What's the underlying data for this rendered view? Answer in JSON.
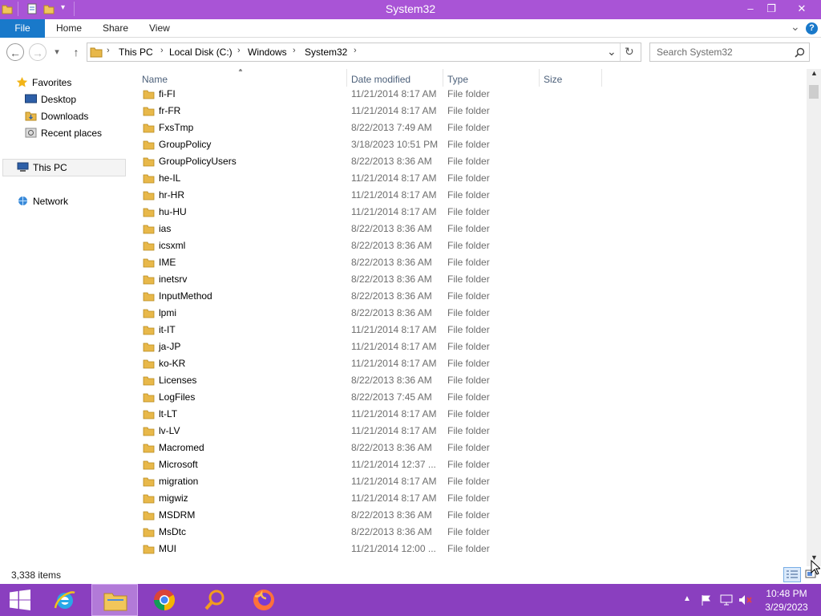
{
  "window": {
    "title": "System32",
    "minimize": "–",
    "restore": "❐",
    "close": "✕"
  },
  "ribbon": {
    "tabs": [
      "File",
      "Home",
      "Share",
      "View"
    ],
    "expand": "⌄",
    "help": "?"
  },
  "nav": {
    "back": "←",
    "forward": "→",
    "recent": "▾",
    "up": "↑",
    "breadcrumbs": [
      "This PC",
      "Local Disk (C:)",
      "Windows",
      "System32"
    ],
    "dropdown": "⌄",
    "refresh": "↻",
    "search_placeholder": "Search System32"
  },
  "sidebar": {
    "favorites": "Favorites",
    "favorite_items": [
      "Desktop",
      "Downloads",
      "Recent places"
    ],
    "this_pc": "This PC",
    "network": "Network"
  },
  "columns": {
    "name": "Name",
    "date": "Date modified",
    "type": "Type",
    "size": "Size"
  },
  "files": [
    {
      "name": "fi-FI",
      "date": "11/21/2014 8:17 AM",
      "type": "File folder"
    },
    {
      "name": "fr-FR",
      "date": "11/21/2014 8:17 AM",
      "type": "File folder"
    },
    {
      "name": "FxsTmp",
      "date": "8/22/2013 7:49 AM",
      "type": "File folder"
    },
    {
      "name": "GroupPolicy",
      "date": "3/18/2023 10:51 PM",
      "type": "File folder"
    },
    {
      "name": "GroupPolicyUsers",
      "date": "8/22/2013 8:36 AM",
      "type": "File folder"
    },
    {
      "name": "he-IL",
      "date": "11/21/2014 8:17 AM",
      "type": "File folder"
    },
    {
      "name": "hr-HR",
      "date": "11/21/2014 8:17 AM",
      "type": "File folder"
    },
    {
      "name": "hu-HU",
      "date": "11/21/2014 8:17 AM",
      "type": "File folder"
    },
    {
      "name": "ias",
      "date": "8/22/2013 8:36 AM",
      "type": "File folder"
    },
    {
      "name": "icsxml",
      "date": "8/22/2013 8:36 AM",
      "type": "File folder"
    },
    {
      "name": "IME",
      "date": "8/22/2013 8:36 AM",
      "type": "File folder"
    },
    {
      "name": "inetsrv",
      "date": "8/22/2013 8:36 AM",
      "type": "File folder"
    },
    {
      "name": "InputMethod",
      "date": "8/22/2013 8:36 AM",
      "type": "File folder"
    },
    {
      "name": "lpmi",
      "date": "8/22/2013 8:36 AM",
      "type": "File folder"
    },
    {
      "name": "it-IT",
      "date": "11/21/2014 8:17 AM",
      "type": "File folder"
    },
    {
      "name": "ja-JP",
      "date": "11/21/2014 8:17 AM",
      "type": "File folder"
    },
    {
      "name": "ko-KR",
      "date": "11/21/2014 8:17 AM",
      "type": "File folder"
    },
    {
      "name": "Licenses",
      "date": "8/22/2013 8:36 AM",
      "type": "File folder"
    },
    {
      "name": "LogFiles",
      "date": "8/22/2013 7:45 AM",
      "type": "File folder"
    },
    {
      "name": "lt-LT",
      "date": "11/21/2014 8:17 AM",
      "type": "File folder"
    },
    {
      "name": "lv-LV",
      "date": "11/21/2014 8:17 AM",
      "type": "File folder"
    },
    {
      "name": "Macromed",
      "date": "8/22/2013 8:36 AM",
      "type": "File folder"
    },
    {
      "name": "Microsoft",
      "date": "11/21/2014 12:37 ...",
      "type": "File folder"
    },
    {
      "name": "migration",
      "date": "11/21/2014 8:17 AM",
      "type": "File folder"
    },
    {
      "name": "migwiz",
      "date": "11/21/2014 8:17 AM",
      "type": "File folder"
    },
    {
      "name": "MSDRM",
      "date": "8/22/2013 8:36 AM",
      "type": "File folder"
    },
    {
      "name": "MsDtc",
      "date": "8/22/2013 8:36 AM",
      "type": "File folder"
    },
    {
      "name": "MUI",
      "date": "11/21/2014 12:00 ...",
      "type": "File folder"
    }
  ],
  "status": {
    "item_count": "3,338 items"
  },
  "taskbar": {
    "apps": [
      "start-button",
      "internet-explorer",
      "file-explorer",
      "chrome",
      "search",
      "firefox"
    ],
    "time": "10:48 PM",
    "date": "3/29/2023"
  },
  "colors": {
    "title_bar": "#a954d6",
    "taskbar": "#8a3fbf",
    "file_tab": "#1979ca",
    "folder": "#e8b84a"
  }
}
